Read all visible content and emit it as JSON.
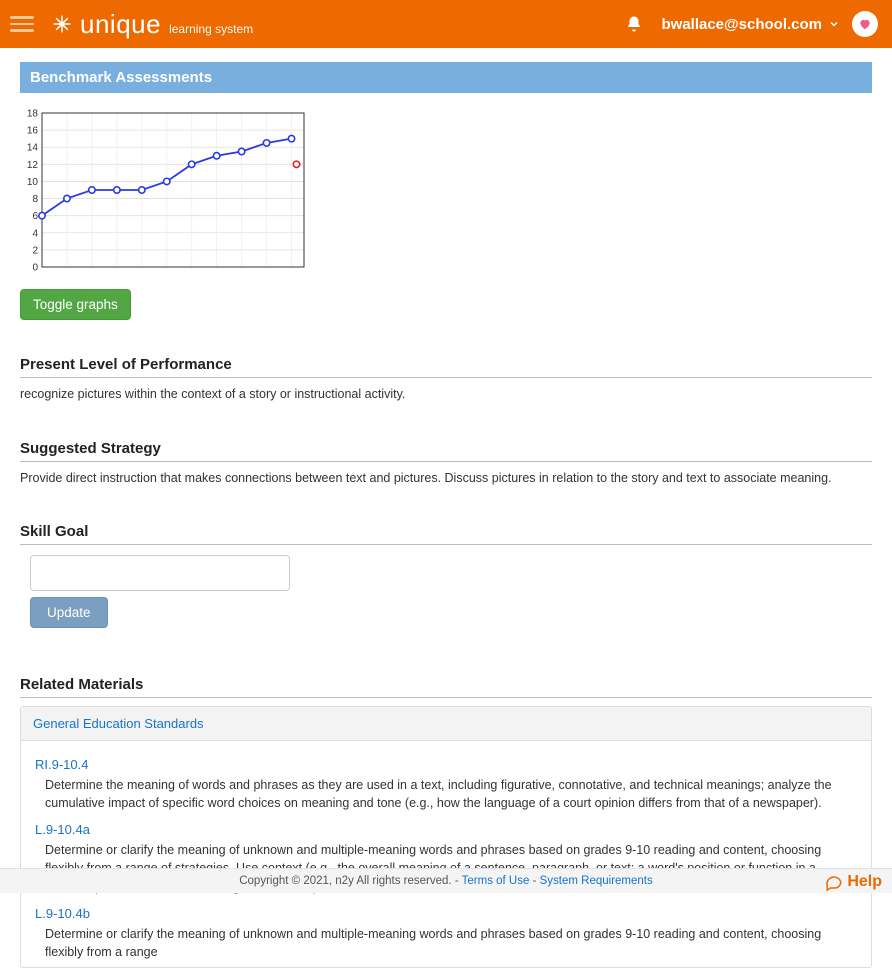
{
  "header": {
    "brand_main": "unique",
    "brand_sub": "learning system",
    "user_email": "bwallace@school.com"
  },
  "sections": {
    "benchmark_title": "Benchmark Assessments",
    "toggle_button": "Toggle graphs",
    "present_level_heading": "Present Level of Performance",
    "present_level_text": "recognize pictures within the context of a story or instructional activity.",
    "strategy_heading": "Suggested Strategy",
    "strategy_text": "Provide direct instruction that makes connections between text and pictures. Discuss pictures in relation to the story and text to associate meaning.",
    "skill_goal_heading": "Skill Goal",
    "update_button": "Update",
    "related_heading": "Related Materials",
    "panel_title": "General Education Standards"
  },
  "standards": [
    {
      "code": "RI.9-10.4",
      "desc": "Determine the meaning of words and phrases as they are used in a text, including figurative, connotative, and technical meanings; analyze the cumulative impact of specific word choices on meaning and tone (e.g., how the language of a court opinion differs from that of a newspaper)."
    },
    {
      "code": "L.9-10.4a",
      "desc": "Determine or clarify the meaning of unknown and multiple-meaning words and phrases based on grades 9-10 reading and content, choosing flexibly from a range of strategies. Use context (e.g., the overall meaning of a sentence, paragraph, or text; a word's position or function in a sentence) as a clue to the meaning of a word or phrase."
    },
    {
      "code": "L.9-10.4b",
      "desc": "Determine or clarify the meaning of unknown and multiple-meaning words and phrases based on grades 9-10 reading and content, choosing flexibly from a range"
    }
  ],
  "footer": {
    "copyright": "Copyright © 2021, n2y All rights reserved. - ",
    "terms": "Terms of Use",
    "sep": " - ",
    "sysreq": "System Requirements"
  },
  "help_label": "Help",
  "chart_data": {
    "type": "line",
    "x": [
      1,
      2,
      3,
      4,
      5,
      6,
      7,
      8,
      9,
      10,
      11
    ],
    "values": [
      6,
      8,
      9,
      9,
      9,
      10,
      12,
      13,
      13.5,
      14.5,
      15
    ],
    "extra_point": {
      "x": 11.2,
      "y": 12,
      "color": "red"
    },
    "y_ticks": [
      0,
      2,
      4,
      6,
      8,
      10,
      12,
      14,
      16,
      18
    ],
    "ylim": [
      0,
      18
    ],
    "xlim": [
      1,
      11.5
    ]
  }
}
